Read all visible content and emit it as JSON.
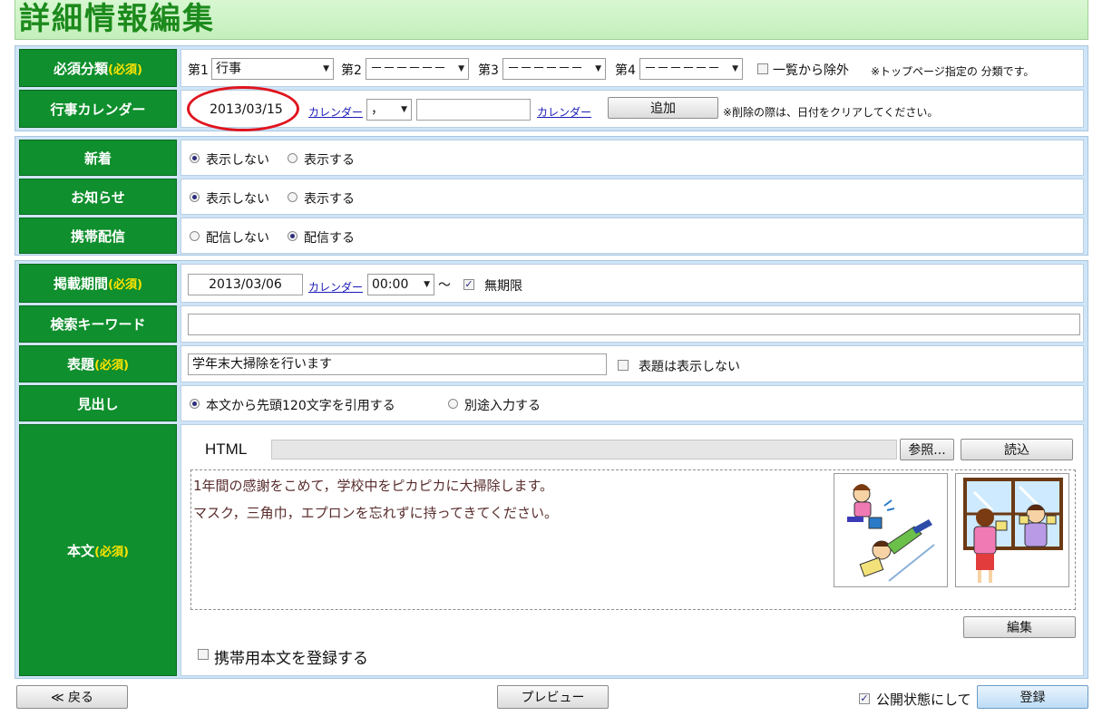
{
  "page_title": "詳細情報編集",
  "category": {
    "label": "必須分類",
    "required": "(必須)",
    "slots": [
      {
        "prefix": "第1",
        "value": "行事"
      },
      {
        "prefix": "第2",
        "value": "－－－－－－"
      },
      {
        "prefix": "第3",
        "value": "－－－－－－"
      },
      {
        "prefix": "第4",
        "value": "－－－－－－"
      }
    ],
    "exclude_label": "一覧から除外",
    "note": "※トップページ指定の 分類です。"
  },
  "event_calendar": {
    "label": "行事カレンダー",
    "date": "2013/03/15",
    "calendar_link": "カレンダー",
    "separator": "，",
    "date2": "",
    "calendar_link2": "カレンダー",
    "add_button": "追加",
    "note": "※削除の際は、日付をクリアしてください。"
  },
  "new_arrival": {
    "label": "新着",
    "opt_off": "表示しない",
    "opt_on": "表示する",
    "selected": "off"
  },
  "notice": {
    "label": "お知らせ",
    "opt_off": "表示しない",
    "opt_on": "表示する",
    "selected": "off"
  },
  "mobile": {
    "label": "携帯配信",
    "opt_off": "配信しない",
    "opt_on": "配信する",
    "selected": "on"
  },
  "period": {
    "label": "掲載期間",
    "required": "(必須)",
    "date": "2013/03/06",
    "calendar_link": "カレンダー",
    "time": "00:00",
    "tilde": "～",
    "unlimited_label": "無期限",
    "unlimited_checked": true
  },
  "keyword": {
    "label": "検索キーワード",
    "value": ""
  },
  "heading": {
    "label": "表題",
    "required": "(必須)",
    "value": "学年末大掃除を行います",
    "hide_label": "表題は表示しない"
  },
  "summary": {
    "label": "見出し",
    "opt_quote": "本文から先頭120文字を引用する",
    "opt_separate": "別途入力する",
    "selected": "quote"
  },
  "body": {
    "label": "本文",
    "required": "(必須)",
    "html_label": "HTML",
    "browse_button": "参照...",
    "load_button": "読込",
    "line1": "1年間の感謝をこめて，学校中をピカピカに大掃除します。",
    "line2": "マスク，三角巾，エプロンを忘れずに持ってきてください。",
    "edit_button": "編集",
    "mobile_body_label": "携帯用本文を登録する"
  },
  "footer": {
    "back_button": "≪ 戻る",
    "preview_button": "プレビュー",
    "public_label": "公開状態にして",
    "public_checked": true,
    "register_button": "登録"
  }
}
